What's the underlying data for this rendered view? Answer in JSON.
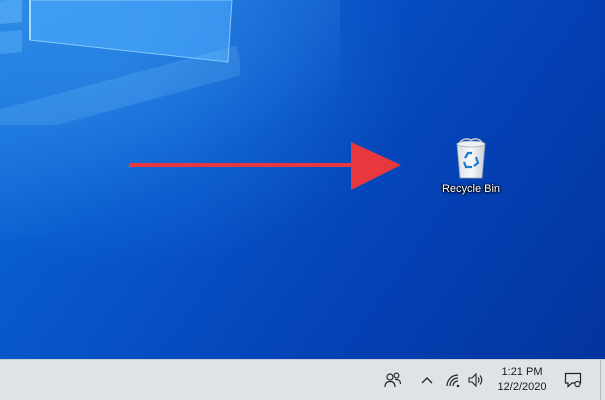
{
  "desktop": {
    "icons": [
      {
        "label": "Recycle Bin",
        "icon": "recycle-bin-icon"
      }
    ],
    "annotation_arrow_color": "#e8383d"
  },
  "taskbar": {
    "background": "#dfe3e8",
    "tray": {
      "icons": [
        "people-icon",
        "chevron-up-icon",
        "wifi-icon",
        "volume-icon"
      ],
      "clock": {
        "time": "1:21 PM",
        "date": "12/2/2020"
      },
      "notification_icon": "action-center-icon"
    }
  }
}
